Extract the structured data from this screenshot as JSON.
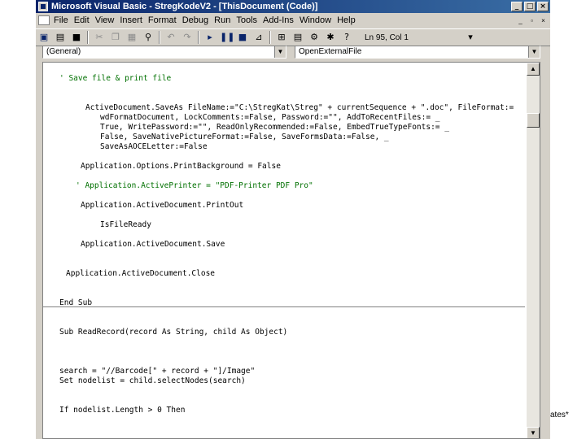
{
  "window": {
    "title": "Microsoft Visual Basic - StregKodeV2 - [ThisDocument (Code)]",
    "controls": [
      "_",
      "□",
      "×"
    ]
  },
  "menubar": {
    "items": [
      "File",
      "Edit",
      "View",
      "Insert",
      "Format",
      "Debug",
      "Run",
      "Tools",
      "Add-Ins",
      "Window",
      "Help"
    ],
    "controls": [
      "_",
      "▫",
      "×"
    ]
  },
  "toolbar": {
    "position_text": "Ln 95, Col 1"
  },
  "combos": {
    "object": "(General)",
    "procedure": "OpenExternalFile"
  },
  "code": {
    "lines": [
      "' Save file & print file",
      "ActiveDocument.SaveAs FileName:=\"C:\\StregKat\\Streg\" + currentSequence + \".doc\", FileFormat:=",
      "wdFormatDocument, LockComments:=False, Password:=\"\", AddToRecentFiles:= _",
      "True, WritePassword:=\"\", ReadOnlyRecommended:=False, EmbedTrueTypeFonts:= _",
      "False, SaveNativePictureFormat:=False, SaveFormsData:=False, _",
      "SaveAsAOCELetter:=False",
      "Application.Options.PrintBackground = False",
      "' Application.ActivePrinter = \"PDF-Printer PDF Pro\"",
      "Application.ActiveDocument.PrintOut",
      "IsFileReady",
      "Application.ActiveDocument.Save",
      "Application.ActiveDocument.Close",
      "End Sub",
      "Sub ReadRecord(record As String, child As Object)",
      "search = \"//Barcode[\" + record + \"]/Image\"",
      "Set nodelist = child.selectNodes(search)",
      "If nodelist.Length > 0 Then"
    ]
  },
  "overflow_text": "ates*",
  "colors": {
    "title_start": "#0a246a",
    "title_end": "#3a6ea5",
    "chrome": "#d4d0c8",
    "comment": "#007000"
  }
}
